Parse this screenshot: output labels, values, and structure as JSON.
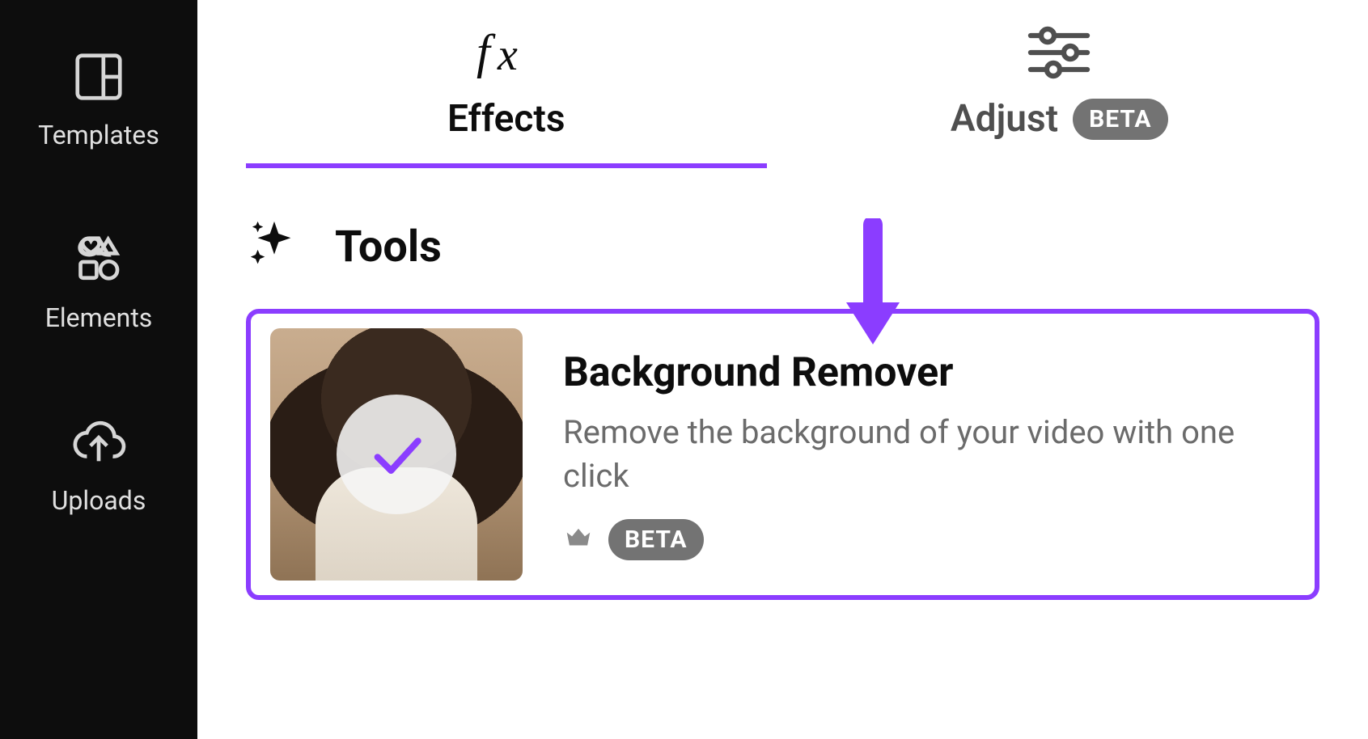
{
  "sidebar": {
    "items": [
      {
        "label": "Templates"
      },
      {
        "label": "Elements"
      },
      {
        "label": "Uploads"
      }
    ]
  },
  "tabs": {
    "effects": {
      "label": "Effects"
    },
    "adjust": {
      "label": "Adjust",
      "badge": "BETA"
    }
  },
  "tools": {
    "heading": "Tools",
    "items": [
      {
        "title": "Background Remover",
        "description": "Remove the background of your video with one click",
        "badge": "BETA",
        "selected": true,
        "premium": true
      }
    ]
  },
  "colors": {
    "accent": "#8b3dff",
    "badge_bg": "#737373"
  }
}
